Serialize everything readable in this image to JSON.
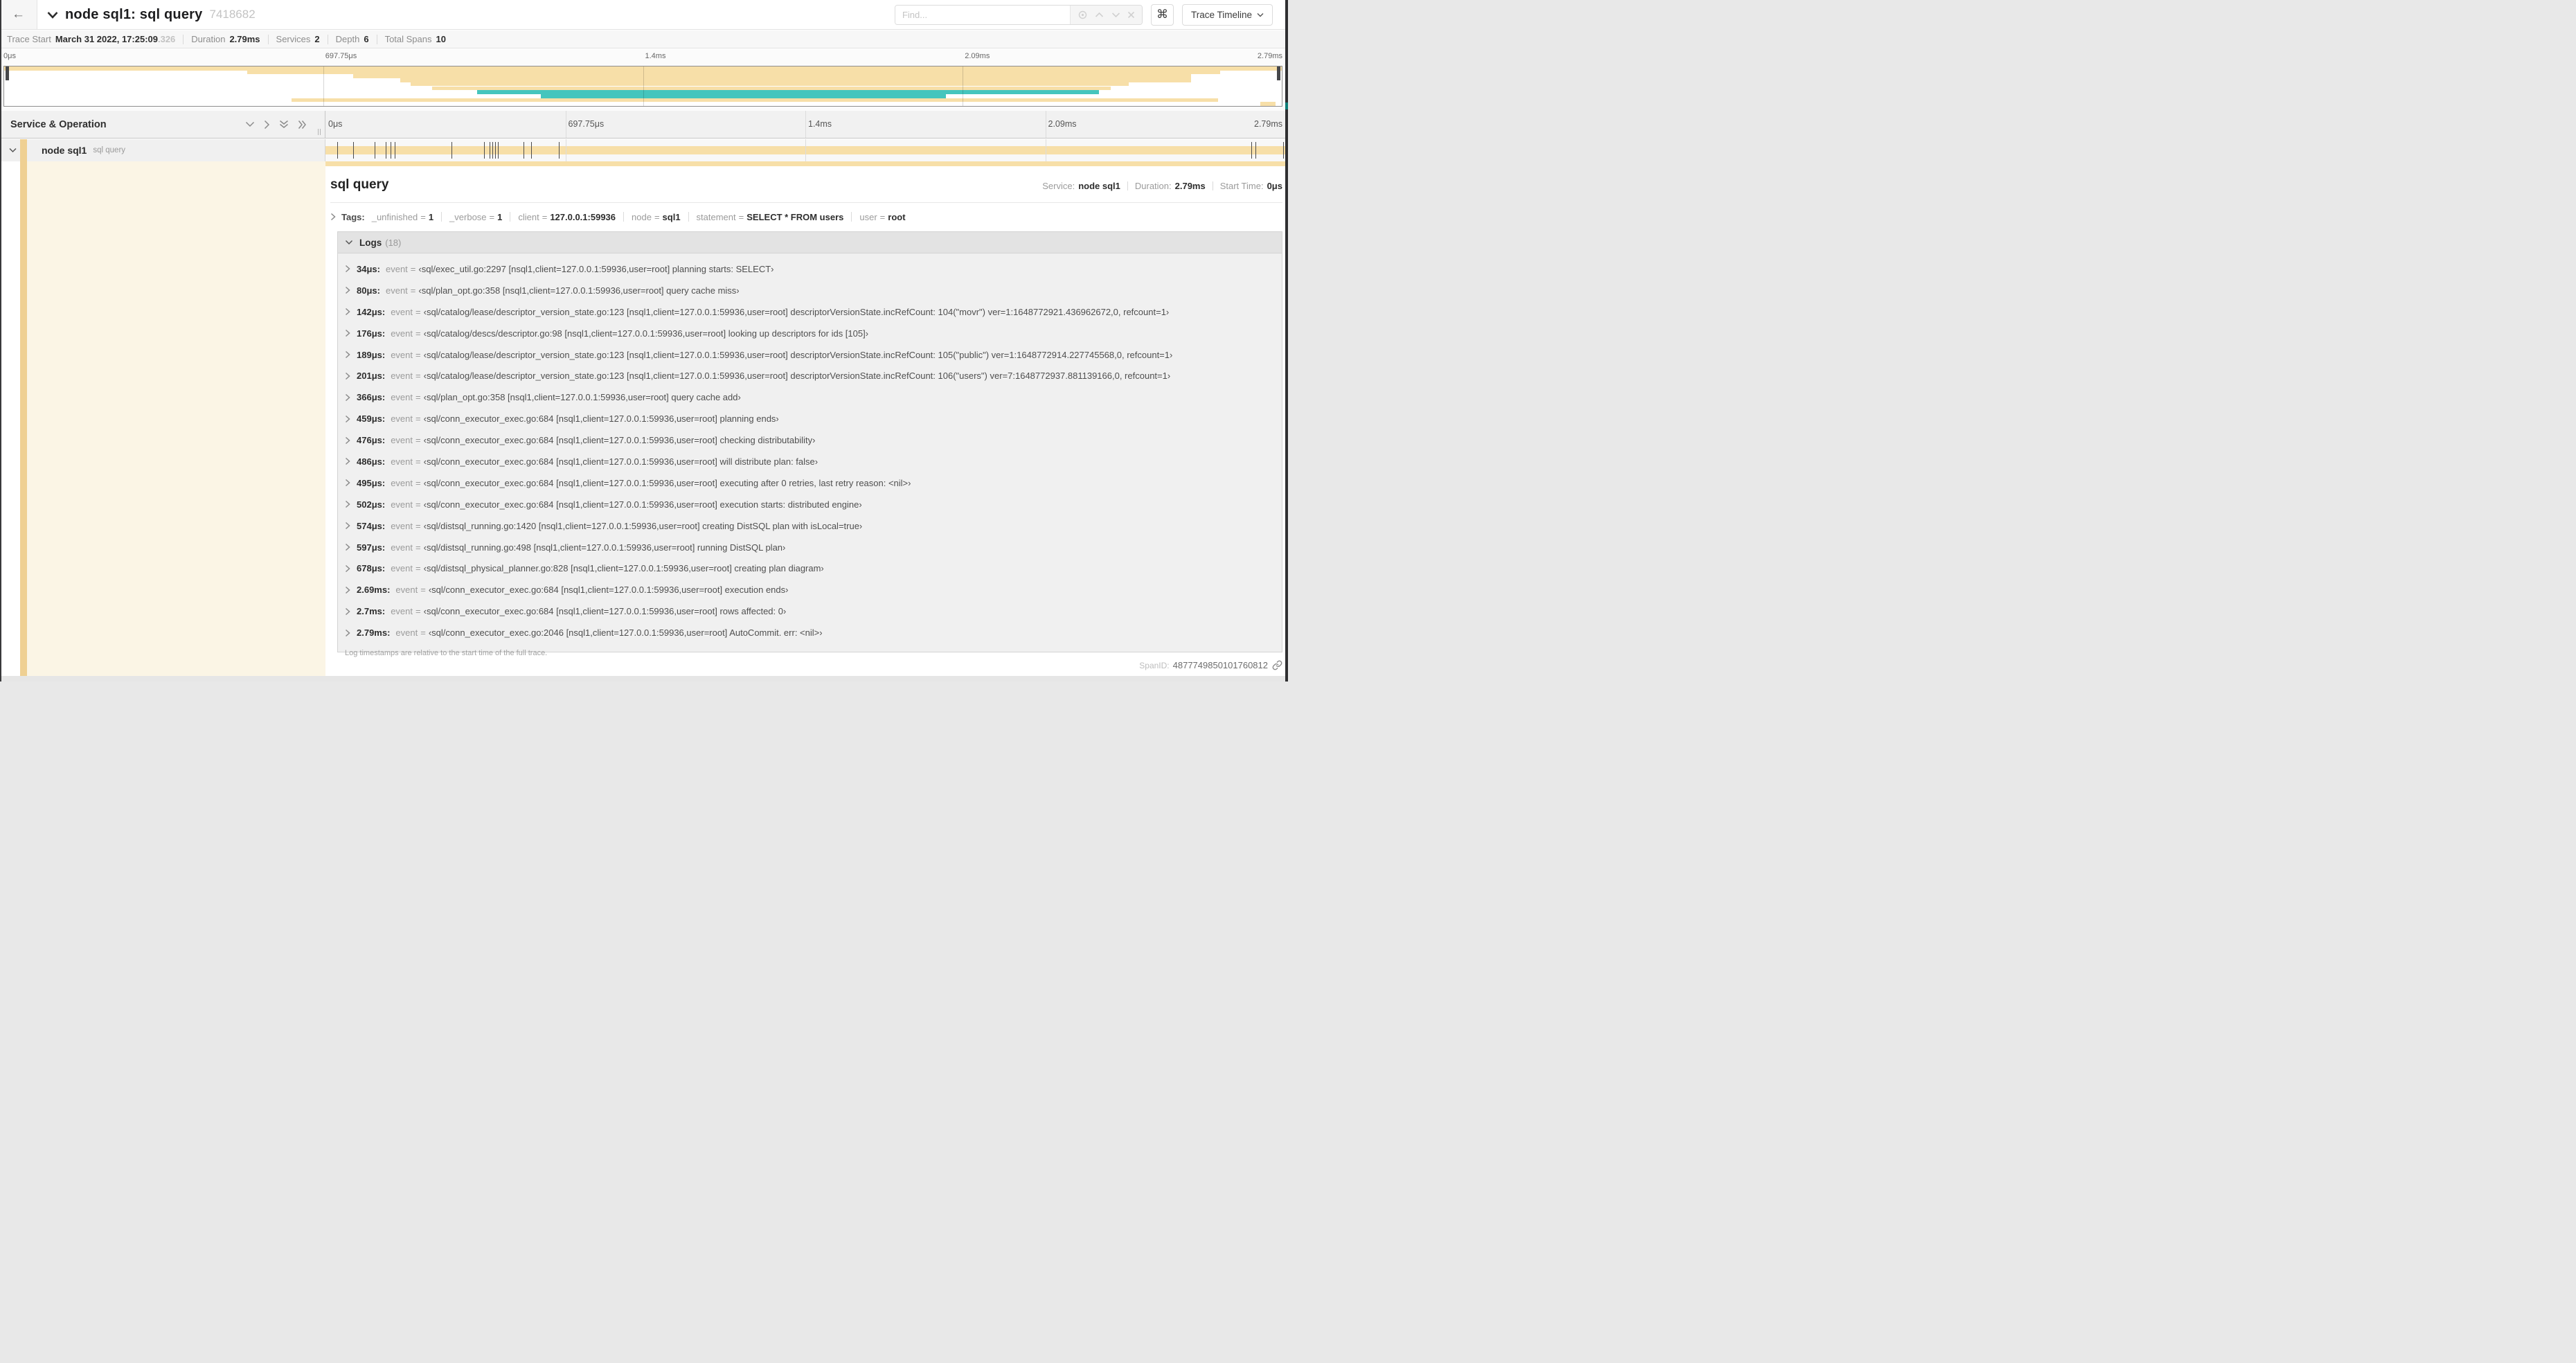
{
  "header": {
    "back_icon": "←",
    "title": "node sql1: sql query",
    "trace_id": "7418682",
    "find_placeholder": "Find...",
    "shortcut_key": "⌘",
    "view_selector": "Trace Timeline"
  },
  "trace_meta": {
    "items": [
      {
        "label": "Trace Start",
        "value": "March 31 2022, 17:25:09",
        "muted": ".326"
      },
      {
        "label": "Duration",
        "value": "2.79ms",
        "muted": ""
      },
      {
        "label": "Services",
        "value": "2",
        "muted": ""
      },
      {
        "label": "Depth",
        "value": "6",
        "muted": ""
      },
      {
        "label": "Total Spans",
        "value": "10",
        "muted": ""
      }
    ]
  },
  "timeline": {
    "tick_labels": [
      "0μs",
      "697.75μs",
      "1.4ms",
      "2.09ms",
      "2.79ms"
    ],
    "grid_pcts": [
      25,
      50,
      75
    ]
  },
  "minimap": {
    "colors": {
      "tan": "#F7DFA8",
      "teal": "#45C5BD"
    },
    "spans": [
      {
        "start": 0,
        "end": 100,
        "color": "tan"
      },
      {
        "start": 19,
        "end": 95.2,
        "color": "tan"
      },
      {
        "start": 27.3,
        "end": 92.9,
        "color": "tan"
      },
      {
        "start": 31,
        "end": 92.9,
        "color": "tan"
      },
      {
        "start": 31.8,
        "end": 88,
        "color": "tan"
      },
      {
        "start": 33.5,
        "end": 86.6,
        "color": "tan"
      },
      {
        "start": 37,
        "end": 85.7,
        "color": "teal"
      },
      {
        "start": 42,
        "end": 73.7,
        "color": "teal"
      },
      {
        "start": 22.5,
        "end": 95,
        "color": "tan"
      },
      {
        "start": 98.3,
        "end": 99.5,
        "color": "tan"
      }
    ]
  },
  "columns": {
    "header": "Service & Operation"
  },
  "span_row": {
    "service": "node sql1",
    "operation": "sql query",
    "tick_pcts": [
      1.2,
      2.9,
      5.1,
      6.3,
      6.8,
      7.2,
      13.1,
      16.5,
      17.1,
      17.4,
      17.7,
      18,
      20.6,
      21.4,
      24.3,
      96.5,
      96.9,
      99.8
    ]
  },
  "detail": {
    "operation": "sql query",
    "meta": [
      {
        "label": "Service:",
        "value": "node sql1"
      },
      {
        "label": "Duration:",
        "value": "2.79ms"
      },
      {
        "label": "Start Time:",
        "value": "0μs"
      }
    ],
    "tags_label": "Tags:",
    "tags": [
      {
        "key": "_unfinished",
        "value": "1"
      },
      {
        "key": "_verbose",
        "value": "1"
      },
      {
        "key": "client",
        "value": "127.0.0.1:59936"
      },
      {
        "key": "node",
        "value": "sql1"
      },
      {
        "key": "statement",
        "value": "SELECT * FROM users"
      },
      {
        "key": "user",
        "value": "root"
      }
    ],
    "logs_label": "Logs",
    "logs_count": "(18)",
    "logs": [
      {
        "time": "34μs:",
        "key": "event",
        "value": "‹sql/exec_util.go:2297 [nsql1,client=127.0.0.1:59936,user=root] planning starts: SELECT›"
      },
      {
        "time": "80μs:",
        "key": "event",
        "value": "‹sql/plan_opt.go:358 [nsql1,client=127.0.0.1:59936,user=root] query cache miss›"
      },
      {
        "time": "142μs:",
        "key": "event",
        "value": "‹sql/catalog/lease/descriptor_version_state.go:123 [nsql1,client=127.0.0.1:59936,user=root] descriptorVersionState.incRefCount: 104(\"movr\") ver=1:1648772921.436962672,0, refcount=1›"
      },
      {
        "time": "176μs:",
        "key": "event",
        "value": "‹sql/catalog/descs/descriptor.go:98 [nsql1,client=127.0.0.1:59936,user=root] looking up descriptors for ids [105]›"
      },
      {
        "time": "189μs:",
        "key": "event",
        "value": "‹sql/catalog/lease/descriptor_version_state.go:123 [nsql1,client=127.0.0.1:59936,user=root] descriptorVersionState.incRefCount: 105(\"public\") ver=1:1648772914.227745568,0, refcount=1›"
      },
      {
        "time": "201μs:",
        "key": "event",
        "value": "‹sql/catalog/lease/descriptor_version_state.go:123 [nsql1,client=127.0.0.1:59936,user=root] descriptorVersionState.incRefCount: 106(\"users\") ver=7:1648772937.881139166,0, refcount=1›"
      },
      {
        "time": "366μs:",
        "key": "event",
        "value": "‹sql/plan_opt.go:358 [nsql1,client=127.0.0.1:59936,user=root] query cache add›"
      },
      {
        "time": "459μs:",
        "key": "event",
        "value": "‹sql/conn_executor_exec.go:684 [nsql1,client=127.0.0.1:59936,user=root] planning ends›"
      },
      {
        "time": "476μs:",
        "key": "event",
        "value": "‹sql/conn_executor_exec.go:684 [nsql1,client=127.0.0.1:59936,user=root] checking distributability›"
      },
      {
        "time": "486μs:",
        "key": "event",
        "value": "‹sql/conn_executor_exec.go:684 [nsql1,client=127.0.0.1:59936,user=root] will distribute plan: false›"
      },
      {
        "time": "495μs:",
        "key": "event",
        "value": "‹sql/conn_executor_exec.go:684 [nsql1,client=127.0.0.1:59936,user=root] executing after 0 retries, last retry reason: <nil>›"
      },
      {
        "time": "502μs:",
        "key": "event",
        "value": "‹sql/conn_executor_exec.go:684 [nsql1,client=127.0.0.1:59936,user=root] execution starts: distributed engine›"
      },
      {
        "time": "574μs:",
        "key": "event",
        "value": "‹sql/distsql_running.go:1420 [nsql1,client=127.0.0.1:59936,user=root] creating DistSQL plan with isLocal=true›"
      },
      {
        "time": "597μs:",
        "key": "event",
        "value": "‹sql/distsql_running.go:498 [nsql1,client=127.0.0.1:59936,user=root] running DistSQL plan›"
      },
      {
        "time": "678μs:",
        "key": "event",
        "value": "‹sql/distsql_physical_planner.go:828 [nsql1,client=127.0.0.1:59936,user=root] creating plan diagram›"
      },
      {
        "time": "2.69ms:",
        "key": "event",
        "value": "‹sql/conn_executor_exec.go:684 [nsql1,client=127.0.0.1:59936,user=root] execution ends›"
      },
      {
        "time": "2.7ms:",
        "key": "event",
        "value": "‹sql/conn_executor_exec.go:684 [nsql1,client=127.0.0.1:59936,user=root] rows affected: 0›"
      },
      {
        "time": "2.79ms:",
        "key": "event",
        "value": "‹sql/conn_executor_exec.go:2046 [nsql1,client=127.0.0.1:59936,user=root] AutoCommit. err: <nil>›"
      }
    ],
    "logs_note": "Log timestamps are relative to the start time of the full trace.",
    "span_id_label": "SpanID:",
    "span_id": "4877749850101760812"
  }
}
